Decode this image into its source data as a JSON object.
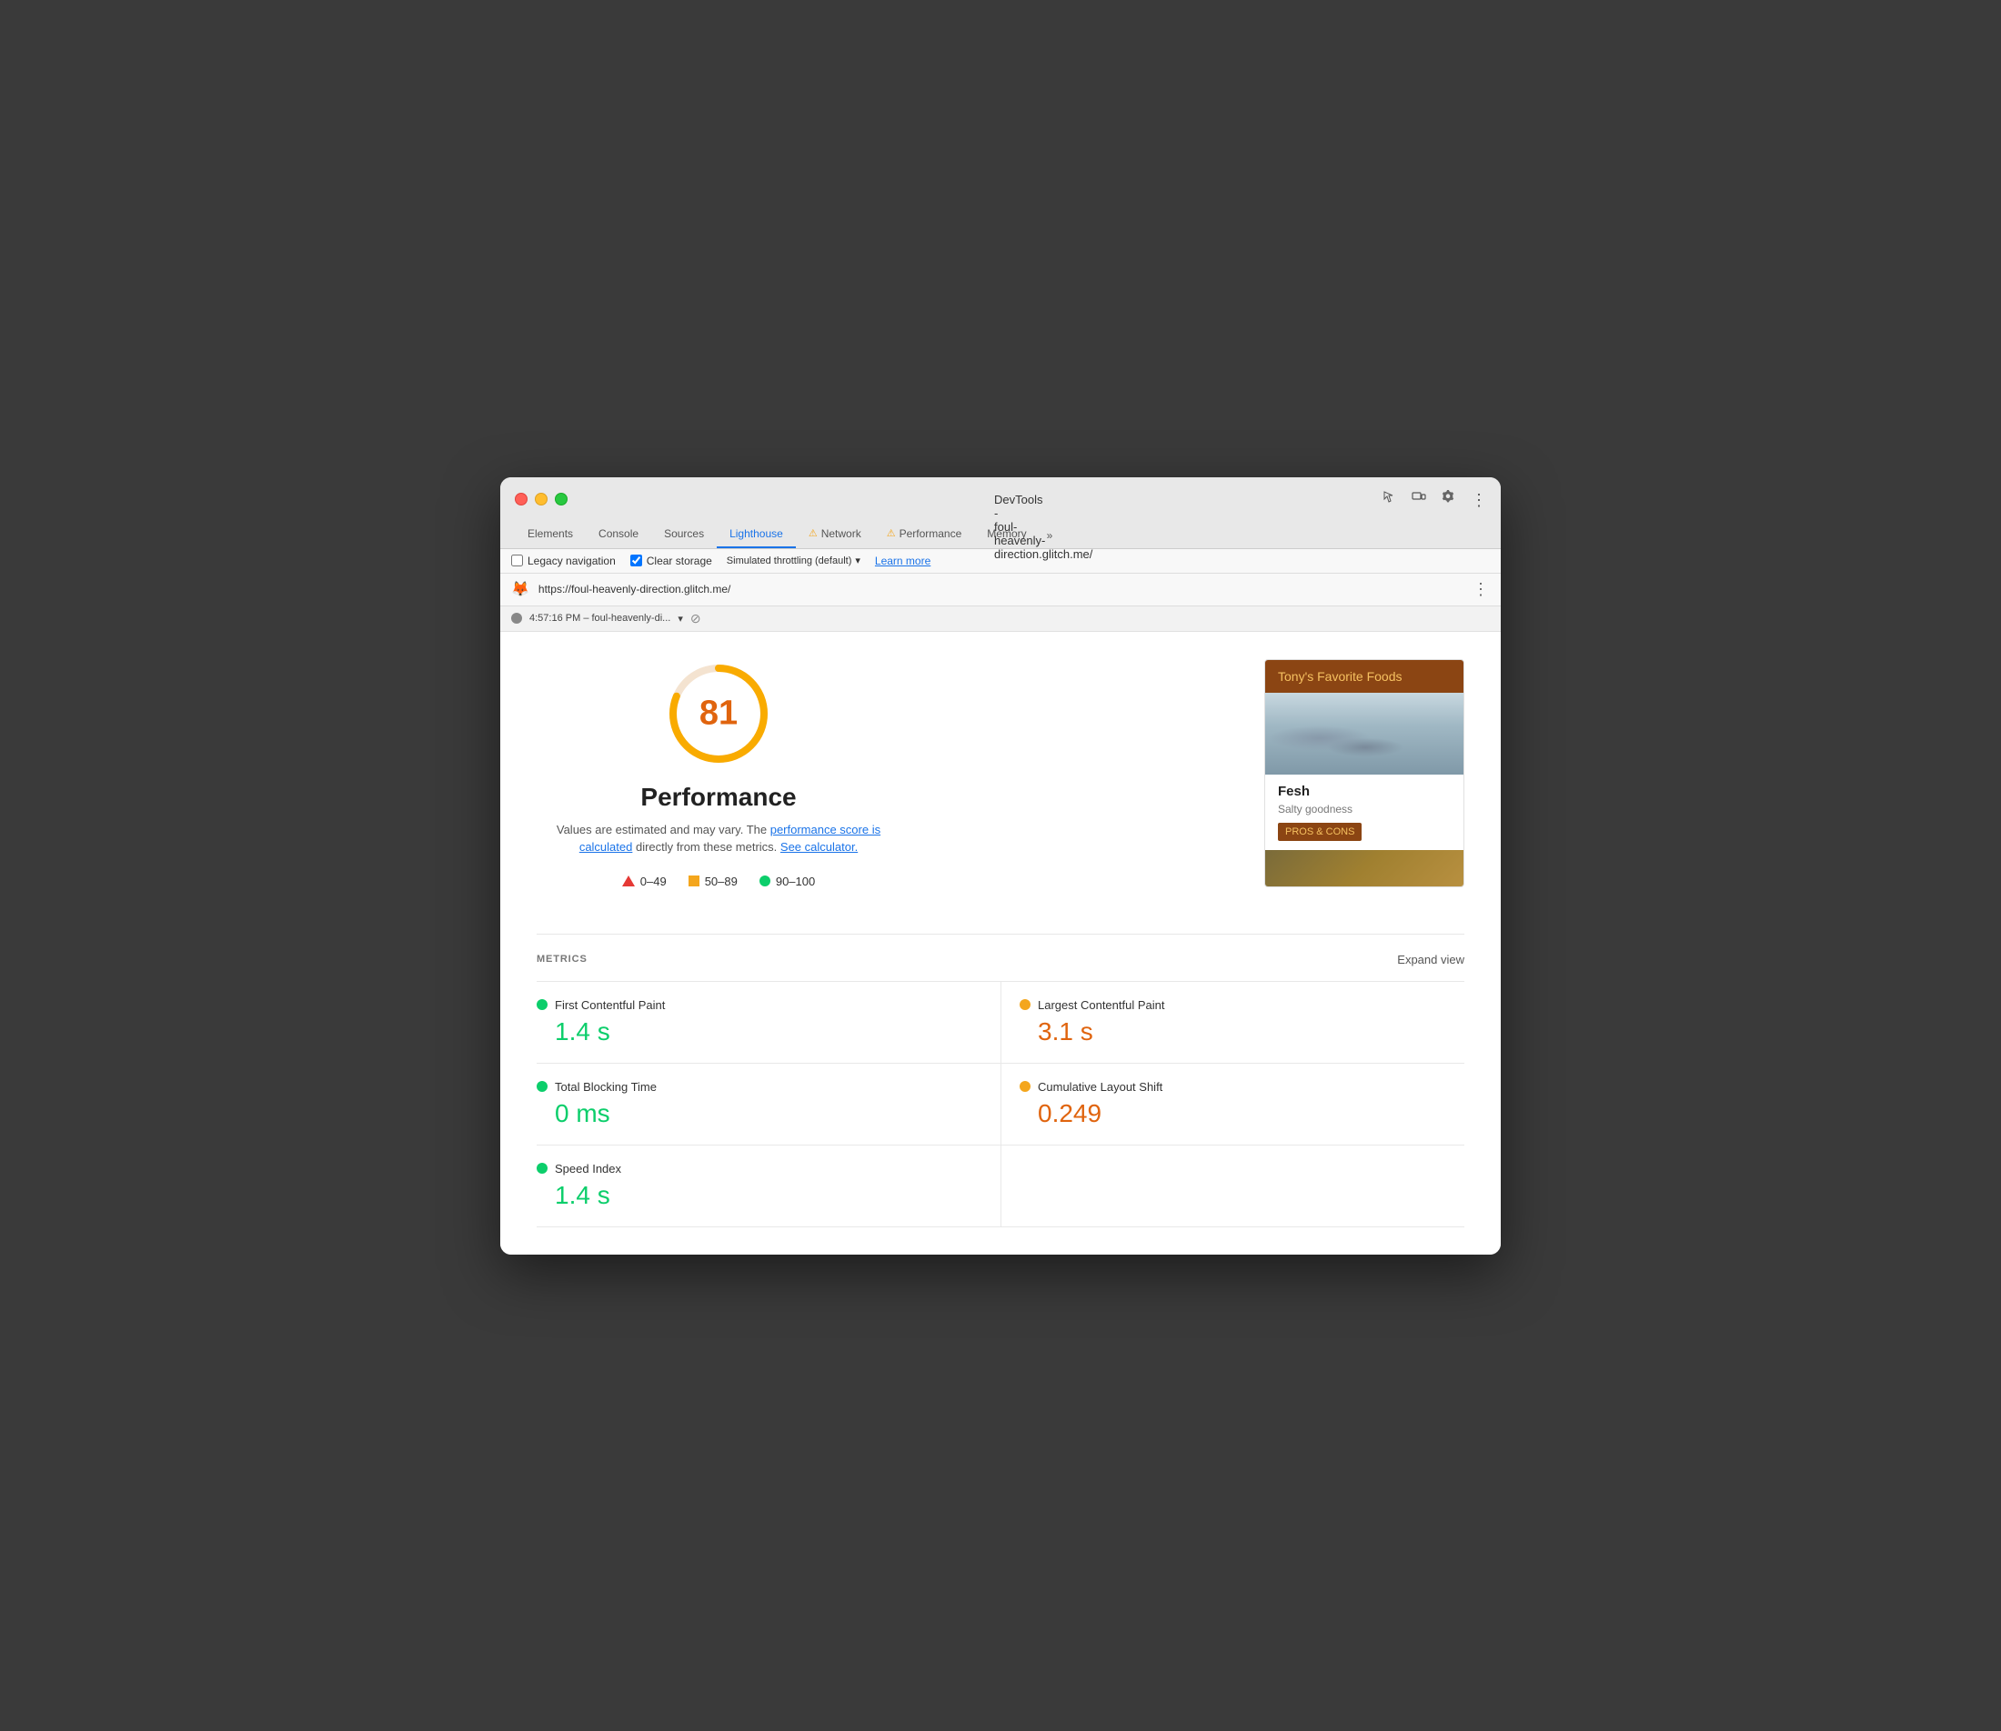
{
  "window": {
    "title": "DevTools - foul-heavenly-direction.glitch.me/"
  },
  "tabs": {
    "items": [
      {
        "label": "Elements",
        "active": false,
        "warning": false
      },
      {
        "label": "Console",
        "active": false,
        "warning": false
      },
      {
        "label": "Sources",
        "active": false,
        "warning": false
      },
      {
        "label": "Lighthouse",
        "active": true,
        "warning": false
      },
      {
        "label": "Network",
        "active": false,
        "warning": true
      },
      {
        "label": "Performance",
        "active": false,
        "warning": true
      },
      {
        "label": "Memory",
        "active": false,
        "warning": false
      }
    ],
    "more_label": "»"
  },
  "secondary_toolbar": {
    "legacy_nav_label": "Legacy navigation",
    "clear_storage_label": "Clear storage",
    "throttling_label": "Simulated throttling (default)",
    "learn_more_label": "Learn more",
    "clear_storage_checked": true,
    "legacy_nav_checked": false
  },
  "url_bar": {
    "url": "https://foul-heavenly-direction.glitch.me/"
  },
  "session": {
    "timestamp": "4:57:16 PM – foul-heavenly-di..."
  },
  "score_section": {
    "score": "81",
    "title": "Performance",
    "description_plain": "Values are estimated and may vary. The ",
    "description_link1": "performance score is calculated",
    "description_mid": " directly from these metrics. ",
    "description_link2": "See calculator.",
    "legend": [
      {
        "label": "0–49",
        "type": "triangle",
        "color": "#e53935"
      },
      {
        "label": "50–89",
        "type": "square",
        "color": "#f4a61d"
      },
      {
        "label": "90–100",
        "type": "circle",
        "color": "#0cce6b"
      }
    ]
  },
  "preview_card": {
    "header": "Tony's Favorite Foods",
    "item_title": "Fesh",
    "item_subtitle": "Salty goodness",
    "pros_cons_label": "PROS & CONS"
  },
  "metrics": {
    "section_label": "METRICS",
    "expand_label": "Expand view",
    "items": [
      {
        "name": "First Contentful Paint",
        "value": "1.4 s",
        "color": "green",
        "col": 0
      },
      {
        "name": "Largest Contentful Paint",
        "value": "3.1 s",
        "color": "orange",
        "col": 1
      },
      {
        "name": "Total Blocking Time",
        "value": "0 ms",
        "color": "green",
        "col": 0
      },
      {
        "name": "Cumulative Layout Shift",
        "value": "0.249",
        "color": "orange",
        "col": 1
      },
      {
        "name": "Speed Index",
        "value": "1.4 s",
        "color": "green",
        "col": 0
      }
    ]
  },
  "colors": {
    "score_ring_bg": "#f4e3d0",
    "score_ring_fill": "#e0640e",
    "score_ring_orange": "#f9ab00",
    "active_tab": "#1a73e8",
    "preview_header_bg": "#8b4513",
    "preview_header_text": "#f5c060"
  }
}
